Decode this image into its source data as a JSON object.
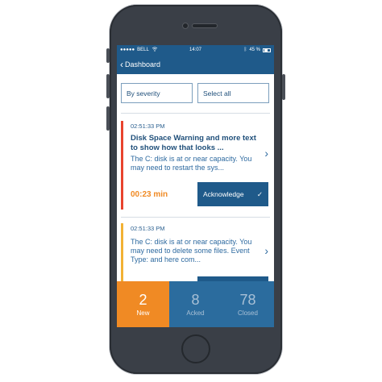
{
  "status_bar": {
    "carrier": "BELL",
    "time": "14:07",
    "battery": "45 %"
  },
  "nav": {
    "back_label": "Dashboard"
  },
  "filters": {
    "severity_label": "By severity",
    "select_all_label": "Select all"
  },
  "alerts": [
    {
      "time": "02:51:33 PM",
      "title": "Disk Space Warning and more text to show how that looks ...",
      "description": "The C: disk is at or near capacity. You may need to restart the sys...",
      "elapsed": "00:23 min",
      "action_label": "Acknowledge",
      "severity_color": "#e8432e"
    },
    {
      "time": "02:51:33 PM",
      "description": "The C: disk is at or near capacity. You may need to delete some files. Event Type: and here com...",
      "severity_color": "#f2b134"
    }
  ],
  "tabs": [
    {
      "count": "2",
      "label": "New"
    },
    {
      "count": "8",
      "label": "Acked"
    },
    {
      "count": "78",
      "label": "Closed"
    }
  ],
  "colors": {
    "brand": "#1f5a8a",
    "accent": "#f08a24"
  }
}
